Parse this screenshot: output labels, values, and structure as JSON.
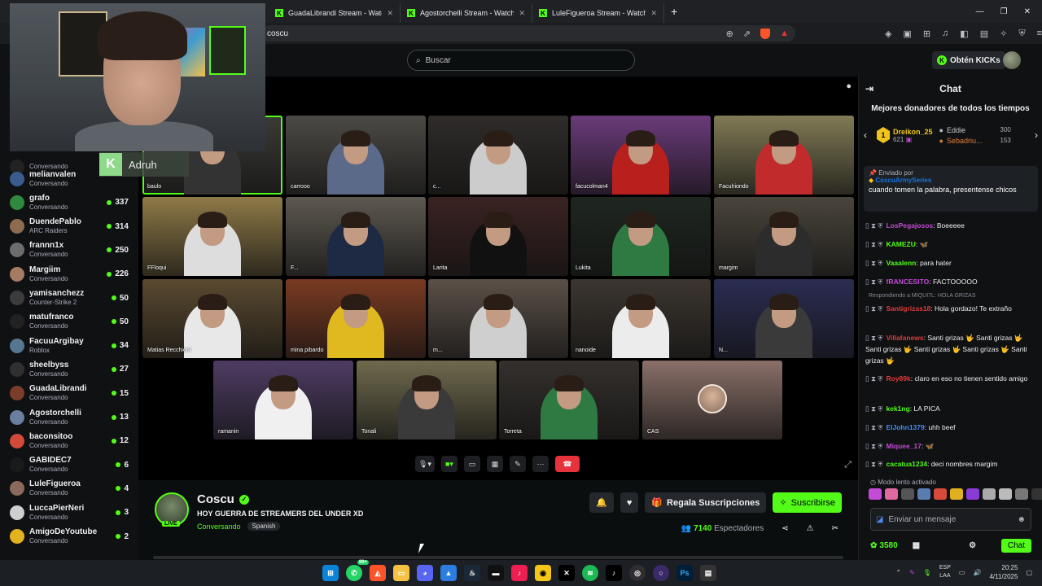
{
  "browser": {
    "tabs": [
      {
        "label": "GuadaLibrandi Stream - Watch Live o"
      },
      {
        "label": "Agostorchelli Stream - Watch Live on"
      },
      {
        "label": "LuleFigueroa Stream - Watch Live on"
      }
    ],
    "url": "coscu"
  },
  "header": {
    "search_placeholder": "Buscar",
    "get_kicks": "Obtén KICKs"
  },
  "sidebar": {
    "items": [
      {
        "name": "",
        "status": "Conversando",
        "count": ""
      },
      {
        "name": "melianvalen",
        "status": "Conversando",
        "count": "",
        "color": "#3b5b8f"
      },
      {
        "name": "grafo",
        "status": "Conversando",
        "count": "337",
        "color": "#2d8a3e"
      },
      {
        "name": "DuendePablo",
        "status": "ARC Raiders",
        "count": "314",
        "color": "#8c6b4e"
      },
      {
        "name": "frannn1x",
        "status": "Conversando",
        "count": "250",
        "color": "#6d6d6d"
      },
      {
        "name": "Margiim",
        "status": "Conversando",
        "count": "226",
        "color": "#a57b63"
      },
      {
        "name": "yamisanchezz",
        "status": "Counter-Strike 2",
        "count": "50",
        "color": "#3c3c3c"
      },
      {
        "name": "matufranco",
        "status": "Conversando",
        "count": "50",
        "color": "#222"
      },
      {
        "name": "FacuuArgibay",
        "status": "Roblox",
        "count": "34",
        "color": "#56778f"
      },
      {
        "name": "sheelbyss",
        "status": "Conversando",
        "count": "27",
        "color": "#303030"
      },
      {
        "name": "GuadaLibrandi",
        "status": "Conversando",
        "count": "15",
        "color": "#7a3d2a"
      },
      {
        "name": "Agostorchelli",
        "status": "Conversando",
        "count": "13",
        "color": "#6a7ea0"
      },
      {
        "name": "baconsitoo",
        "status": "Conversando",
        "count": "12",
        "color": "#d14a3a"
      },
      {
        "name": "GABIDEC7",
        "status": "Conversando",
        "count": "6",
        "color": "#1a1a1a"
      },
      {
        "name": "LuleFigueroa",
        "status": "Conversando",
        "count": "4",
        "color": "#8a6a5a"
      },
      {
        "name": "LuccaPierNeri",
        "status": "Conversando",
        "count": "3",
        "color": "#cfcfcf"
      },
      {
        "name": "AmigoDeYoutube",
        "status": "Conversando",
        "count": "2",
        "color": "#e3b21f"
      }
    ]
  },
  "overlay": {
    "guest_name": "Adruh",
    "badge_letter": "K"
  },
  "video": {
    "tiles": [
      {
        "label": "baulo",
        "bg": "#3a3a36",
        "shirt": "#333"
      },
      {
        "label": "carrooo",
        "bg": "#4c4a45",
        "shirt": "#5a6a88"
      },
      {
        "label": "c...",
        "bg": "#2f2c2a",
        "shirt": "#cccccc"
      },
      {
        "label": "facucolman4",
        "bg": "#6a3b7a",
        "shirt": "#b8201e"
      },
      {
        "label": "Faculriondo",
        "bg": "#807a55",
        "shirt": "#c22b2b"
      },
      {
        "label": "FFloqui",
        "bg": "#8f7a48",
        "shirt": "#ddd"
      },
      {
        "label": "F...",
        "bg": "#5d5850",
        "shirt": "#1e2a44"
      },
      {
        "label": "Larita",
        "bg": "#3a2222",
        "shirt": "#111"
      },
      {
        "label": "Lukita",
        "bg": "#1f2620",
        "shirt": "#2f7a43"
      },
      {
        "label": "margim",
        "bg": "#4a453c",
        "shirt": "#2c2c2c"
      },
      {
        "label": "Matias Recchioni",
        "bg": "#5a4a30",
        "shirt": "#e8e8e8"
      },
      {
        "label": "mina pibardo",
        "bg": "#7a3b22",
        "shirt": "#e0b820"
      },
      {
        "label": "m...",
        "bg": "#5b5048",
        "shirt": "#cfcfcf"
      },
      {
        "label": "nanoide",
        "bg": "#3c3630",
        "shirt": "#ececec"
      },
      {
        "label": "N...",
        "bg": "#2b2d52",
        "shirt": "#3a3a3a"
      },
      {
        "label": "ramanin",
        "bg": "#4e3c63",
        "shirt": "#f0f0f0"
      },
      {
        "label": "Tonali",
        "bg": "#6f6a4d",
        "shirt": "#3a3a3a"
      },
      {
        "label": "Torreta",
        "bg": "#34302d",
        "shirt": "#2f7a43"
      },
      {
        "label": "CAS",
        "bg": "#8a7069",
        "shirt": ""
      }
    ]
  },
  "channel": {
    "name": "Coscu",
    "title": "HOY GUERRA DE STREAMERS DEL UNDER XD",
    "category": "Conversando",
    "language": "Spanish",
    "live_badge": "LIVE",
    "gift_subs": "Regala Suscripciones",
    "subscribe": "Suscribirse",
    "viewers_count": "7140",
    "viewers_label": "Espectadores"
  },
  "chat": {
    "title": "Chat",
    "donors_title": "Mejores donadores de todos los tiempos",
    "donors": [
      {
        "rank": "1",
        "name": "Dreikon_25",
        "amount": "621"
      },
      {
        "rank": "2",
        "name": "Eddie",
        "amount": "300"
      },
      {
        "rank": "3",
        "name": "Sebadriu...",
        "amount": "153"
      }
    ],
    "pinned": {
      "label": "Enviado por",
      "user": "CoscuArmySeries",
      "message": "cuando tomen la palabra, presentense chicos"
    },
    "messages": [
      {
        "user": "LosPegajosos",
        "color": "#c44bd6",
        "text": ": Boeeeee"
      },
      {
        "user": "KAMEZU",
        "color": "#53fc18",
        "text": ": 🦋"
      },
      {
        "user": "Vaaalenn",
        "color": "#53fc18",
        "text": ": para hater"
      },
      {
        "user": "fRANCESITO",
        "color": "#c44bd6",
        "text": ": FACTOOOOO"
      },
      {
        "user": "Santigrizas18",
        "color": "#e03b3b",
        "text": ": Hola gordazo! Te extraño"
      },
      {
        "user": "Villafanews",
        "color": "#e03b3b",
        "text": ": Santi grizas 🤟 Santi grizas 🤟 Santi grizas 🤟 Santi grizas 🤟 Santi grizas 🤟 Santi grizas 🤟"
      },
      {
        "user": "Roy89k",
        "color": "#e03b3b",
        "text": ": claro en eso no tienen sentido amigo"
      },
      {
        "user": "kek1ng",
        "color": "#53fc18",
        "text": ": LA PICA"
      },
      {
        "user": "ElJohn1379",
        "color": "#4a8cf0",
        "text": ": uhh beef"
      },
      {
        "user": "Miquee_17",
        "color": "#c44bd6",
        "text": ": 🦋"
      },
      {
        "user": "cacatua1234",
        "color": "#53fc18",
        "text": ": deci nombres margim"
      }
    ],
    "reply_note": "Respondiendo a MIQUI7L: HOLA GRIZAS",
    "slow_mode": "Modo lento activado",
    "input_placeholder": "Enviar un mensaje",
    "points": "3580",
    "send_label": "Chat"
  },
  "taskbar": {
    "lang_top": "ESP",
    "lang_bottom": "LAA",
    "time": "20:25",
    "date": "4/11/2025",
    "whatsapp_badge": "99+"
  }
}
